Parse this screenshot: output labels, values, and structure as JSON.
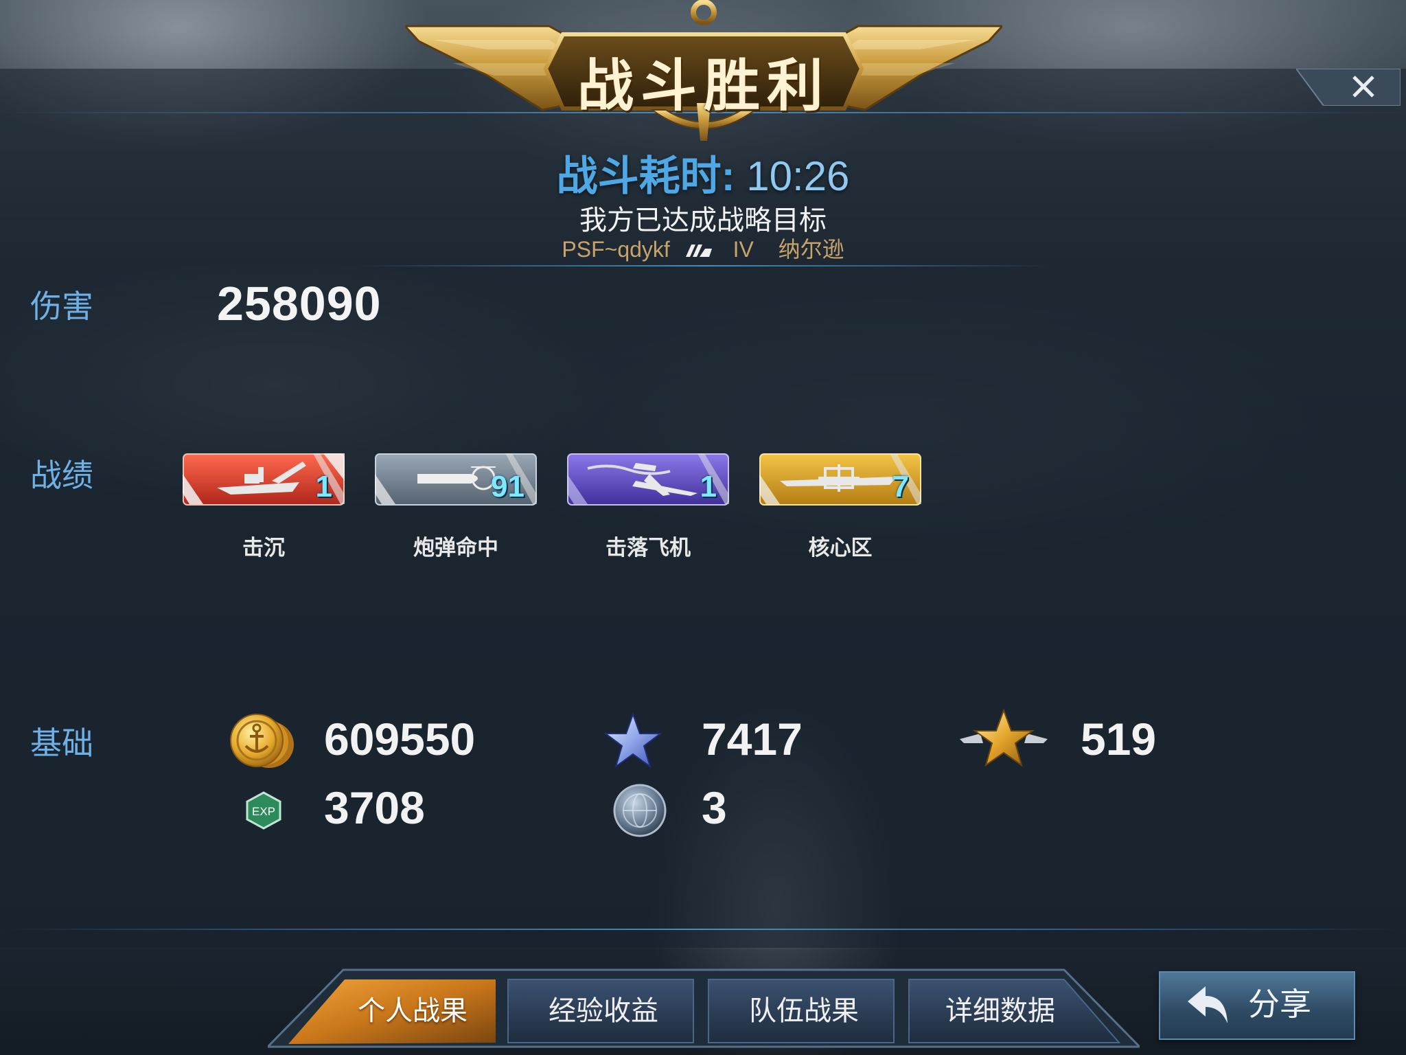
{
  "header": {
    "title": "战斗胜利",
    "close_icon": "close-icon"
  },
  "battle": {
    "duration_label": "战斗耗时:",
    "duration_value": "10:26",
    "result_message": "我方已达成战略目标",
    "player_name": "PSF~qdykf",
    "ship_tier": "IV",
    "ship_name": "纳尔逊"
  },
  "sections": {
    "damage_label": "伤害",
    "record_label": "战绩",
    "basic_label": "基础"
  },
  "damage": {
    "value": "258090"
  },
  "medals": [
    {
      "name": "击沉",
      "count": "1",
      "color": "#d9392a",
      "icon": "warship-icon"
    },
    {
      "name": "炮弹命中",
      "count": "91",
      "color": "#6f7d8c",
      "icon": "shell-icon"
    },
    {
      "name": "击落飞机",
      "count": "1",
      "color": "#5b48b8",
      "icon": "aircraft-icon"
    },
    {
      "name": "核心区",
      "count": "7",
      "color": "#d4a22a",
      "icon": "crosshair-ship-icon"
    }
  ],
  "rewards": {
    "silver": {
      "value": "609550",
      "icon": "gold-coin-icon"
    },
    "exp": {
      "value": "3708",
      "icon": "exp-icon",
      "icon_text": "EXP"
    },
    "blue_star": {
      "value": "7417",
      "icon": "blue-star-icon"
    },
    "globe": {
      "value": "3",
      "icon": "globe-coin-icon"
    },
    "gold_star": {
      "value": "519",
      "icon": "winged-star-icon"
    }
  },
  "tabs": [
    {
      "label": "个人战果",
      "active": true
    },
    {
      "label": "经验收益",
      "active": false
    },
    {
      "label": "队伍战果",
      "active": false
    },
    {
      "label": "详细数据",
      "active": false
    }
  ],
  "share": {
    "label": "分享",
    "icon": "share-arrow-icon"
  },
  "colors": {
    "section_label": "#6fb1e6",
    "duration": "#4fa8e6",
    "player": "#c8a46a",
    "tab_active": "#d98a1e",
    "tab_inactive": "#2b3f56"
  }
}
